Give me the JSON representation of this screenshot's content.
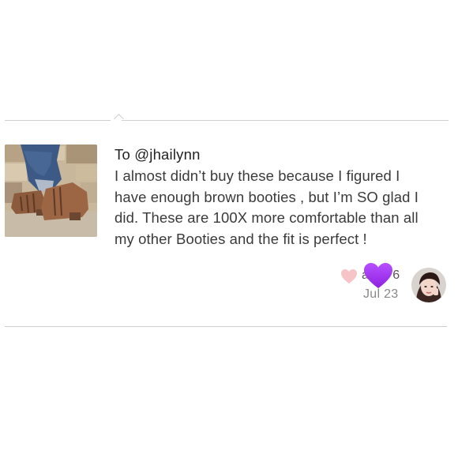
{
  "comment": {
    "mention": "To @jhailynn",
    "lines": [
      "I almost didn’t buy these because I figured I",
      "have enough brown booties , but I’m SO glad I",
      "did. These are 100X more comfortable than all",
      "my other Booties and the fit is perfect !"
    ]
  },
  "meta": {
    "username": "a",
    "username_suffix": "6",
    "timestamp": "Jul 23"
  },
  "icons": {
    "like": "heart-outline-icon",
    "overlay": "purple-heart-emoji",
    "avatar": "user-avatar"
  },
  "colors": {
    "like_heart": "#f6c3c6",
    "purple_heart": "#a239f0",
    "divider": "#cfcfcf"
  }
}
